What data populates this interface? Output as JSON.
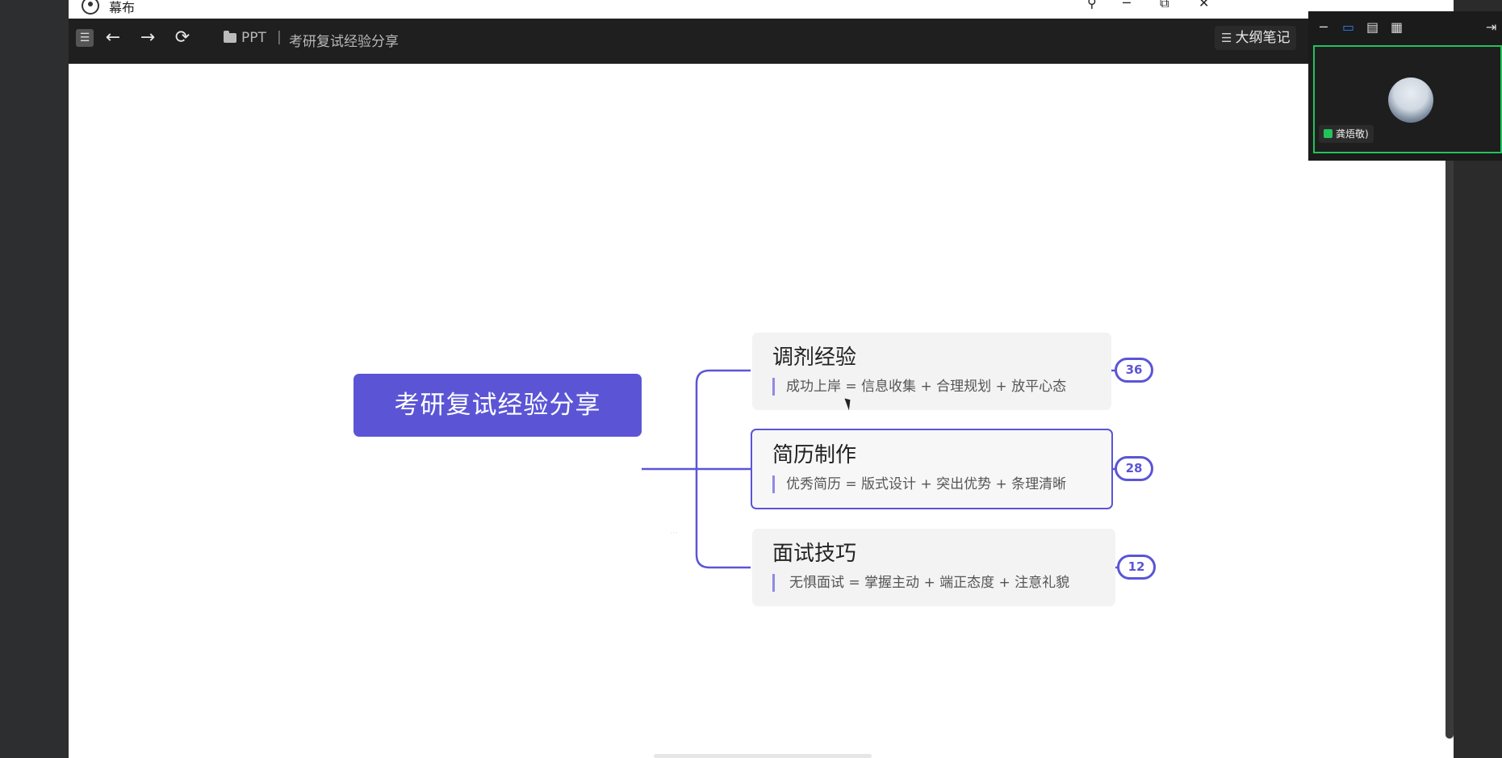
{
  "app": {
    "name": "幕布"
  },
  "window_controls": {
    "pin": "⚲",
    "minimize": "─",
    "restore": "⧉",
    "close": "✕"
  },
  "toolbar": {
    "menu_icon": "☰",
    "back_icon": "←",
    "forward_icon": "→",
    "refresh_icon": "⟳",
    "breadcrumb": [
      "PPT",
      "考研复试经验分享"
    ],
    "breadcrumb_separator": "|",
    "outline_notes_icon": "☰",
    "outline_notes_label": "大纲笔记"
  },
  "palette_icon": "🎨",
  "mindmap": {
    "root": "考研复试经验分享",
    "branches": [
      {
        "title": "调剂经验",
        "desc": "成功上岸 = 信息收集 + 合理规划 + 放平心态",
        "count": "36",
        "selected": false
      },
      {
        "title": "简历制作",
        "desc": "优秀简历 = 版式设计 + 突出优势 + 条理清晰",
        "count": "28",
        "selected": true
      },
      {
        "title": "面试技巧",
        "desc": "无惧面试 = 掌握主动 + 端正态度 + 注意礼貌",
        "count": "12",
        "selected": false
      }
    ]
  },
  "colors": {
    "accent": "#5b55d6",
    "toolbar_bg": "#1f1f1f",
    "node_bg": "#f3f3f4",
    "speaking_border": "#23c25a"
  },
  "video_call": {
    "controls": {
      "minimize": "─",
      "view_speaker": "▭",
      "view_split": "▤",
      "view_grid": "▦",
      "exit": "⇥"
    },
    "participant": {
      "name": "龚焐敬)"
    }
  }
}
